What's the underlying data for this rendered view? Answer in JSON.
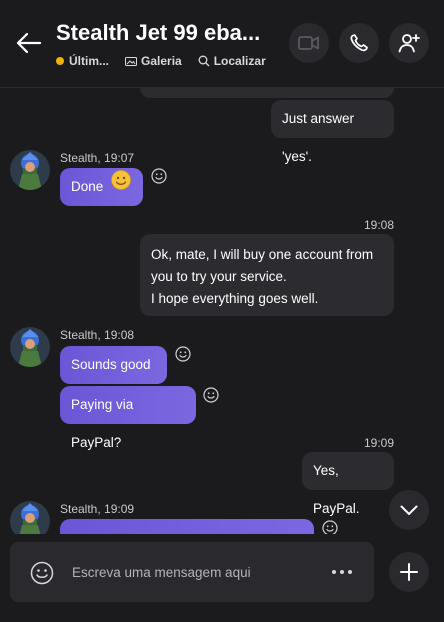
{
  "header": {
    "title": "Stealth Jet 99 eba...",
    "status": "Últim...",
    "gallery": "Galeria",
    "find": "Localizar",
    "status_color": "#f0b400"
  },
  "messages": [
    {
      "type": "outgoing",
      "text": "Just answer 'yes'."
    },
    {
      "type": "incoming",
      "sender_time": "Stealth, 19:07",
      "text": "Done"
    },
    {
      "type": "time",
      "text": "19:08"
    },
    {
      "type": "outgoing",
      "lines": [
        "Ok, mate, I will buy one account from",
        "you to try your service.",
        "I hope everything goes well."
      ]
    },
    {
      "type": "incoming",
      "sender_time": "Stealth, 19:08",
      "text": "Sounds good"
    },
    {
      "type": "incoming",
      "text": "Paying via PayPal?"
    },
    {
      "type": "time",
      "text": "19:09"
    },
    {
      "type": "outgoing",
      "text": "Yes, PayPal."
    },
    {
      "type": "incoming",
      "sender_time": "Stealth, 19:09",
      "text": ""
    }
  ],
  "composer": {
    "placeholder": "Escreva uma mensagem aqui"
  },
  "icons": [
    "back-arrow-icon",
    "video-call-icon",
    "phone-icon",
    "add-person-icon",
    "gallery-icon",
    "search-icon",
    "smiley-icon",
    "emoji-icon",
    "more-icon",
    "plus-icon",
    "chevron-down-icon"
  ],
  "colors": {
    "background": "#1b1b1e",
    "incoming_bubble": "#6b56d6",
    "outgoing_bubble": "#2b2b30",
    "button": "#2a2a2e"
  }
}
